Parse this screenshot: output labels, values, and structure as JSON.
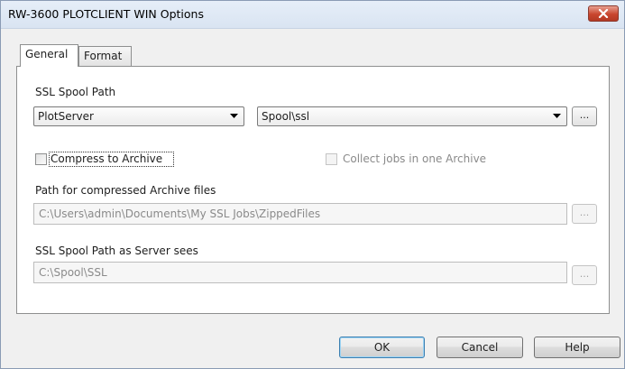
{
  "window": {
    "title": "RW-3600 PLOTCLIENT WIN Options",
    "close_icon": "close-x-icon"
  },
  "tabs": [
    {
      "label": "General",
      "selected": true
    },
    {
      "label": "Format",
      "selected": false
    }
  ],
  "general": {
    "ssl_spool_path_label": "SSL Spool Path",
    "server_combo_value": "PlotServer",
    "spool_combo_value": "Spool\\ssl",
    "browse_label": "...",
    "compress_label": "Compress to Archive",
    "compress_checked": false,
    "collect_label": "Collect jobs in one Archive",
    "collect_checked": false,
    "archive_path_label": "Path for compressed Archive files",
    "archive_path_value": "C:\\Users\\admin\\Documents\\My SSL Jobs\\ZippedFiles",
    "server_sees_label": "SSL Spool Path as Server sees",
    "server_sees_value": "C:\\Spool\\SSL"
  },
  "buttons": {
    "ok": "OK",
    "cancel": "Cancel",
    "help": "Help"
  }
}
